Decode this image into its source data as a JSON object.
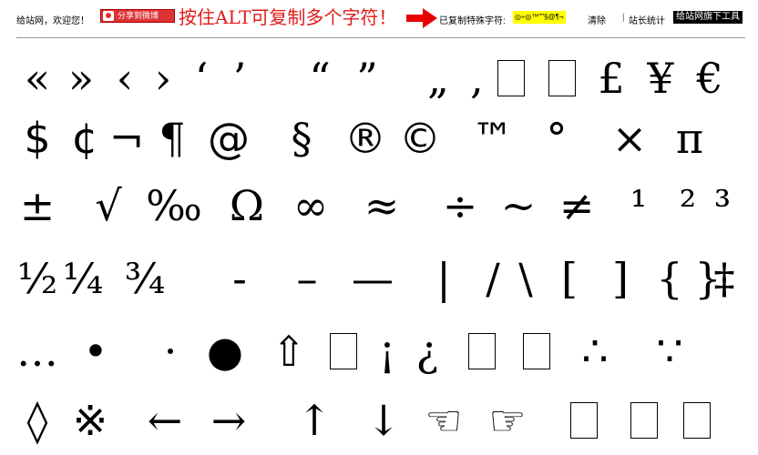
{
  "header": {
    "welcome": "给站网，欢迎您！",
    "share_button": "分享到微博",
    "slogan": "按住ALT可复制多个字符！",
    "copied_label": "已复制特殊字符:",
    "copied_value": "◎÷◎™\"\"§@¶¬",
    "clear_link": "清除",
    "separator": "|",
    "stats_link": "站长统计",
    "tools_link": "给站网旗下工具"
  },
  "colors": {
    "slogan": "#e21a1a",
    "arrow": "#e60000",
    "copied_highlight": "#ffff00",
    "share_bg": "#d33333"
  },
  "characters": [
    [
      "«",
      "»",
      "‹",
      "›",
      "‘",
      "’",
      "“",
      "”",
      "„",
      "‚",
      "□",
      "□",
      "£",
      "¥",
      "€"
    ],
    [
      "$",
      "¢",
      "¬",
      "¶",
      "@",
      "§",
      "®",
      "©",
      "™",
      "°",
      "×",
      "π"
    ],
    [
      "±",
      "√",
      "‰",
      "Ω",
      "∞",
      "≈",
      "÷",
      "~",
      "≠",
      "¹",
      "²",
      "³"
    ],
    [
      "½",
      "¼",
      "¾",
      "-",
      "–",
      "—",
      "|",
      "/",
      "\\",
      "[",
      "]",
      "{",
      "}",
      "†",
      "‡"
    ],
    [
      "…",
      "•",
      "·",
      "●",
      "⇧",
      "□",
      "¡",
      "¿",
      "□",
      "□",
      "∴",
      "∵"
    ],
    [
      "◊",
      "※",
      "←",
      "→",
      "↑",
      "↓",
      "☜",
      "☞",
      "□",
      "□",
      "□"
    ]
  ]
}
